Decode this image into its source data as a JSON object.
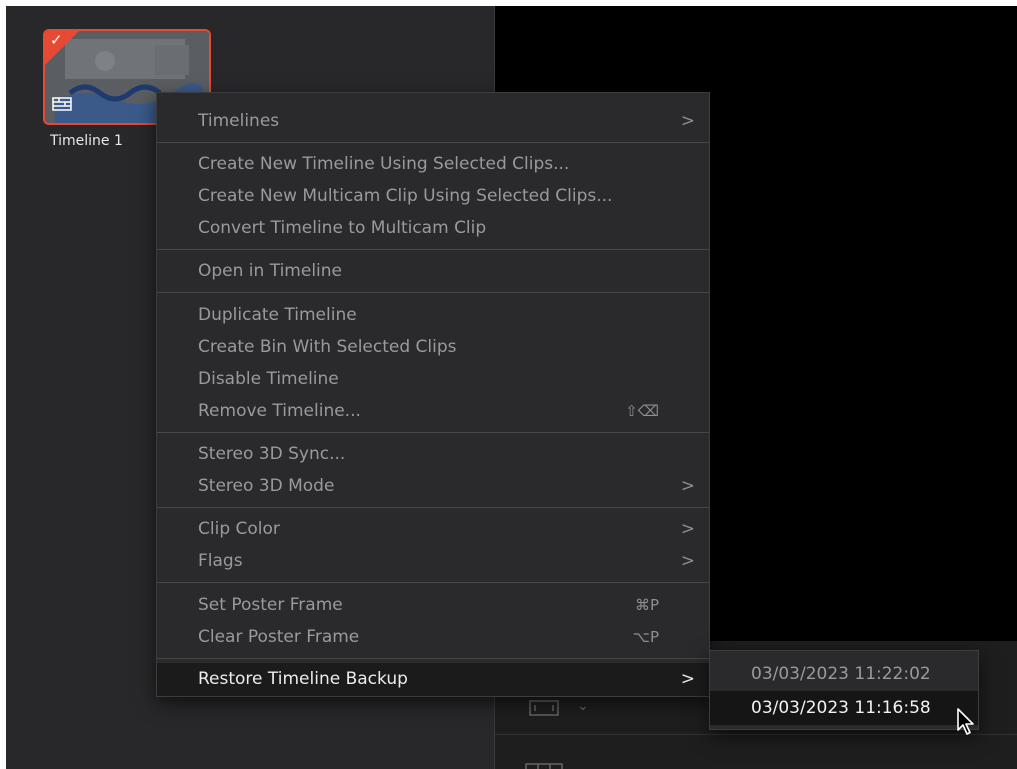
{
  "clip": {
    "name": "Timeline 1"
  },
  "context_menu": {
    "items": [
      {
        "label": "Timelines",
        "shortcut": "",
        "submenu": true
      },
      {
        "label": "Create New Timeline Using Selected Clips...",
        "shortcut": "",
        "submenu": false
      },
      {
        "label": "Create New Multicam Clip Using Selected Clips...",
        "shortcut": "",
        "submenu": false
      },
      {
        "label": "Convert Timeline to Multicam Clip",
        "shortcut": "",
        "submenu": false
      },
      {
        "label": "Open in Timeline",
        "shortcut": "",
        "submenu": false
      },
      {
        "label": "Duplicate Timeline",
        "shortcut": "",
        "submenu": false
      },
      {
        "label": "Create Bin With Selected Clips",
        "shortcut": "",
        "submenu": false
      },
      {
        "label": "Disable Timeline",
        "shortcut": "",
        "submenu": false
      },
      {
        "label": "Remove Timeline...",
        "shortcut": "⇧⌫",
        "submenu": false
      },
      {
        "label": "Stereo 3D Sync...",
        "shortcut": "",
        "submenu": false
      },
      {
        "label": "Stereo 3D Mode",
        "shortcut": "",
        "submenu": true
      },
      {
        "label": "Clip Color",
        "shortcut": "",
        "submenu": true
      },
      {
        "label": "Flags",
        "shortcut": "",
        "submenu": true
      },
      {
        "label": "Set Poster Frame",
        "shortcut": "⌘P",
        "submenu": false
      },
      {
        "label": "Clear Poster Frame",
        "shortcut": "⌥P",
        "submenu": false
      },
      {
        "label": "Restore Timeline Backup",
        "shortcut": "",
        "submenu": true
      }
    ],
    "submenu_arrow": ">"
  },
  "backup_submenu": {
    "items": [
      {
        "label": "03/03/2023 11:22:02"
      },
      {
        "label": "03/03/2023 11:16:58"
      }
    ]
  },
  "colors": {
    "accent": "#e64a34",
    "menu_bg": "#2a2a2c",
    "viewer_bg": "#000000"
  },
  "icons": {
    "check": "✓",
    "chevron_down": "⌄"
  }
}
